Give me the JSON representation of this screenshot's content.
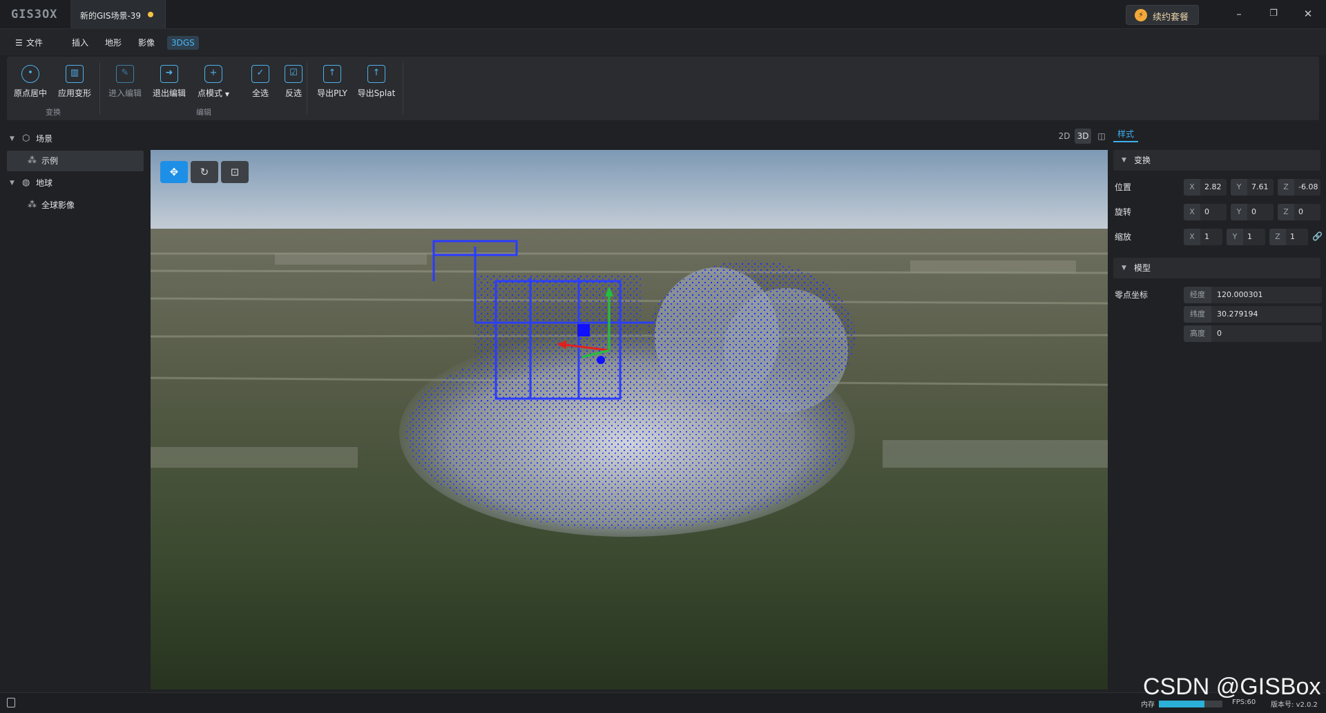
{
  "app": {
    "logo": "GIS3OX",
    "doc_tab": "新的GIS场景-39",
    "renew_label": "续约套餐",
    "window_controls": {
      "minimize": "–",
      "restore": "❐",
      "close": "✕"
    }
  },
  "menu": {
    "file": "文件",
    "items": [
      "插入",
      "地形",
      "影像",
      "3DGS"
    ],
    "active": "3DGS"
  },
  "ribbon": {
    "buttons": [
      {
        "label": "原点居中",
        "icon": "target-icon"
      },
      {
        "label": "应用变形",
        "icon": "map-fold-icon"
      },
      {
        "label": "进入编辑",
        "icon": "edit-icon"
      },
      {
        "label": "退出编辑",
        "icon": "exit-icon"
      },
      {
        "label": "点模式",
        "icon": "hex-plus-icon"
      },
      {
        "label": "全选",
        "icon": "select-all-icon"
      },
      {
        "label": "反选",
        "icon": "invert-select-icon"
      },
      {
        "label": "导出PLY",
        "icon": "export-icon"
      },
      {
        "label": "导出Splat",
        "icon": "export-icon"
      }
    ],
    "groups": {
      "transform": "变换",
      "edit": "编辑"
    }
  },
  "tree": {
    "scene": "场景",
    "example": "示例",
    "earth": "地球",
    "global_imagery": "全球影像"
  },
  "view_modes": {
    "two_d": "2D",
    "three_d": "3D",
    "split": "◫",
    "active": "3D"
  },
  "viewport_tools": [
    "move-tool",
    "rotate-tool",
    "scale-tool"
  ],
  "panel": {
    "tab": "样式",
    "transform_section": "变换",
    "position_label": "位置",
    "rotation_label": "旋转",
    "scale_label": "缩放",
    "position": {
      "x": "2.82",
      "y": "7.61",
      "z": "-6.08"
    },
    "rotation": {
      "x": "0",
      "y": "0",
      "z": "0"
    },
    "scale": {
      "x": "1",
      "y": "1",
      "z": "1"
    },
    "model_section": "模型",
    "origin_label": "零点坐标",
    "longitude_label": "经度",
    "longitude": "120.000301",
    "latitude_label": "纬度",
    "latitude": "30.279194",
    "height_label": "高度",
    "height": "0"
  },
  "status": {
    "memory_label": "内存",
    "memory_fraction": 0.72,
    "fps": "FPS:60",
    "version": "版本号: v2.0.2"
  },
  "watermark": "CSDN @GISBox",
  "colors": {
    "accent": "#3fb0f0",
    "point_blue": "#2020ff",
    "axis_red": "#e02020",
    "axis_green": "#20c040"
  }
}
